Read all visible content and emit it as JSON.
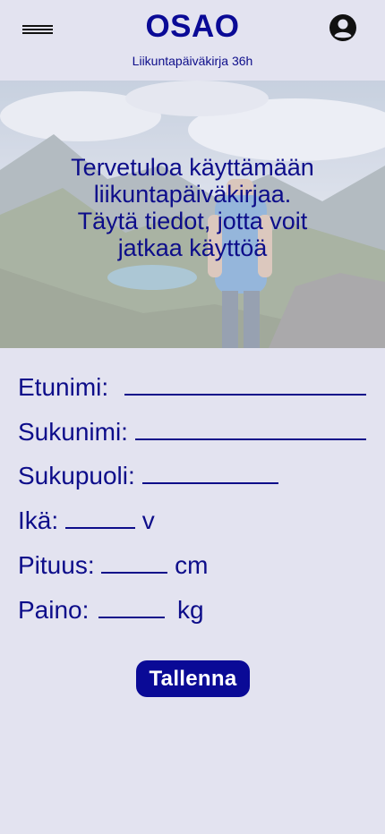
{
  "header": {
    "title": "OSAO",
    "subtitle": "Liikuntapäiväkirja 36h"
  },
  "hero": {
    "lines": [
      "Tervetuloa käyttämään",
      "liikuntapäiväkirjaa.",
      "Täytä tiedot, jotta voit",
      "jatkaa käyttöä"
    ]
  },
  "form": {
    "first_name_label": "Etunimi:",
    "last_name_label": "Sukunimi:",
    "gender_label": "Sukupuoli:",
    "age_label": "Ikä:",
    "age_unit": "v",
    "height_label": "Pituus:",
    "height_unit": "cm",
    "weight_label": "Paino:",
    "weight_unit": "kg",
    "save_label": "Tallenna"
  },
  "colors": {
    "primary": "#0a0a96",
    "background": "#e3e3f0"
  },
  "icons": {
    "menu": "hamburger-menu-icon",
    "profile": "account-circle-icon"
  }
}
